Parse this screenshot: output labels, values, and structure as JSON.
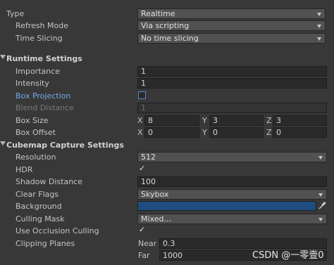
{
  "type": {
    "label": "Type",
    "value": "Realtime"
  },
  "refresh_mode": {
    "label": "Refresh Mode",
    "value": "Via scripting"
  },
  "time_slicing": {
    "label": "Time Slicing",
    "value": "No time slicing"
  },
  "runtime_settings": {
    "title": "Runtime Settings",
    "importance": {
      "label": "Importance",
      "value": "1"
    },
    "intensity": {
      "label": "Intensity",
      "value": "1"
    },
    "box_projection": {
      "label": "Box Projection",
      "checked": false
    },
    "blend_distance": {
      "label": "Blend Distance",
      "value": "1"
    },
    "box_size": {
      "label": "Box Size",
      "x": "8",
      "y": "3",
      "z": "3"
    },
    "box_offset": {
      "label": "Box Offset",
      "x": "0",
      "y": "0",
      "z": "0"
    },
    "axis_x": "X",
    "axis_y": "Y",
    "axis_z": "Z"
  },
  "cubemap": {
    "title": "Cubemap Capture Settings",
    "resolution": {
      "label": "Resolution",
      "value": "512"
    },
    "hdr": {
      "label": "HDR",
      "checked": true
    },
    "shadow_distance": {
      "label": "Shadow Distance",
      "value": "100"
    },
    "clear_flags": {
      "label": "Clear Flags",
      "value": "Skybox"
    },
    "background": {
      "label": "Background",
      "color": "#1f4d80"
    },
    "culling_mask": {
      "label": "Culling Mask",
      "value": "Mixed..."
    },
    "use_occlusion_culling": {
      "label": "Use Occlusion Culling",
      "checked": true
    },
    "clipping_planes": {
      "label": "Clipping Planes",
      "near_label": "Near",
      "near": "0.3",
      "far_label": "Far",
      "far": "1000"
    }
  },
  "checkmark_glyph": "✓",
  "watermark": "CSDN @一零壹0"
}
